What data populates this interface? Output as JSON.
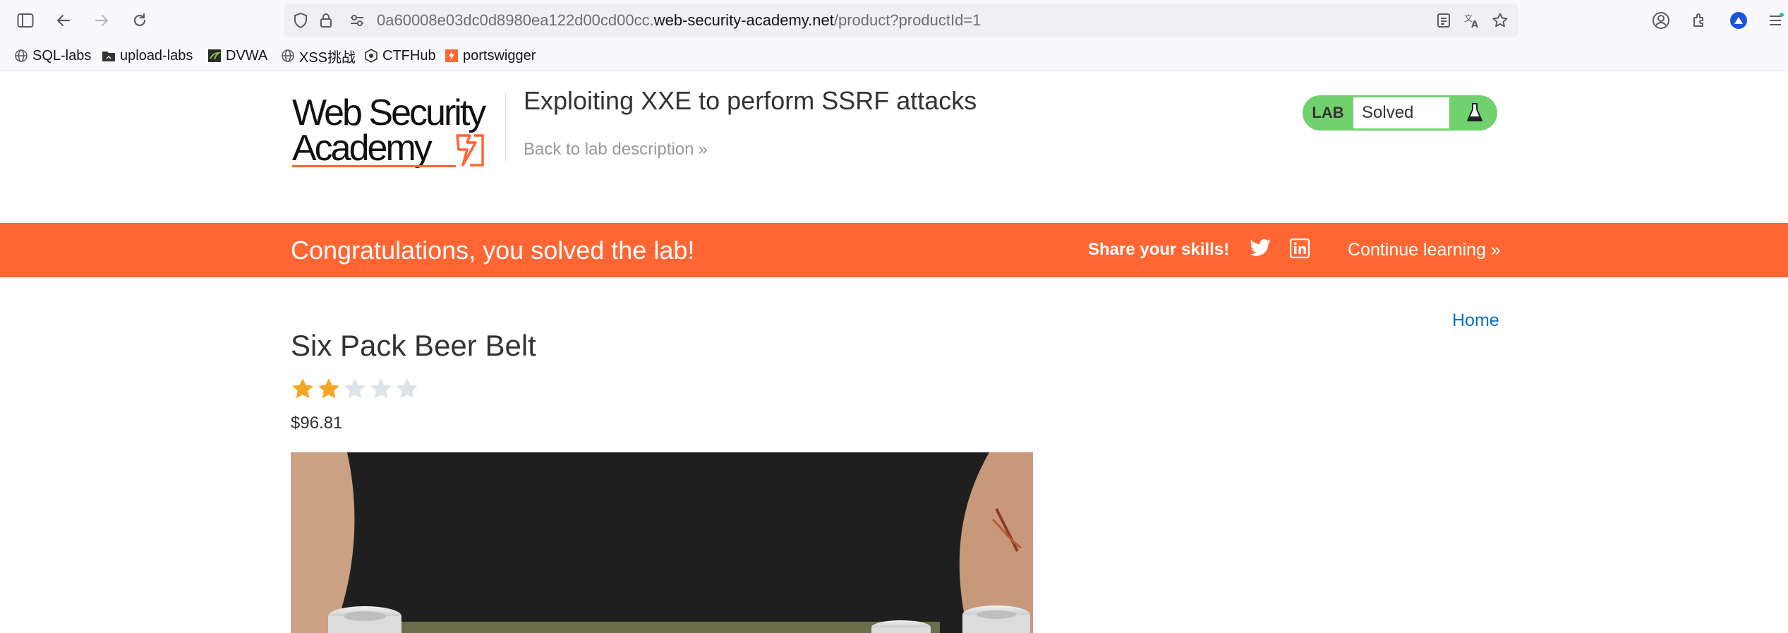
{
  "browser": {
    "url_prefix": "0a60008e03dc0d8980ea122d00cd00cc.",
    "url_host": "web-security-academy.net",
    "url_path": "/product?productId=1",
    "bookmarks": [
      "SQL-labs",
      "upload-labs",
      "DVWA",
      "XSS挑战",
      "CTFHub",
      "portswigger"
    ]
  },
  "header": {
    "logo_line1": "Web Security",
    "logo_line2": "Academy",
    "lab_title": "Exploiting XXE to perform SSRF attacks",
    "back_link": "Back to lab description",
    "lab_tag": "LAB",
    "lab_state": "Solved"
  },
  "banner": {
    "congrats": "Congratulations, you solved the lab!",
    "share": "Share your skills!",
    "continue": "Continue learning"
  },
  "product": {
    "home_link": "Home",
    "title": "Six Pack Beer Belt",
    "rating": 2,
    "max_rating": 5,
    "price": "$96.81"
  },
  "colors": {
    "accent": "#ff6633",
    "solved_green": "#70d16d",
    "link_blue": "#0071bc",
    "star_filled": "#f5a623",
    "star_empty": "#dde3e6"
  }
}
